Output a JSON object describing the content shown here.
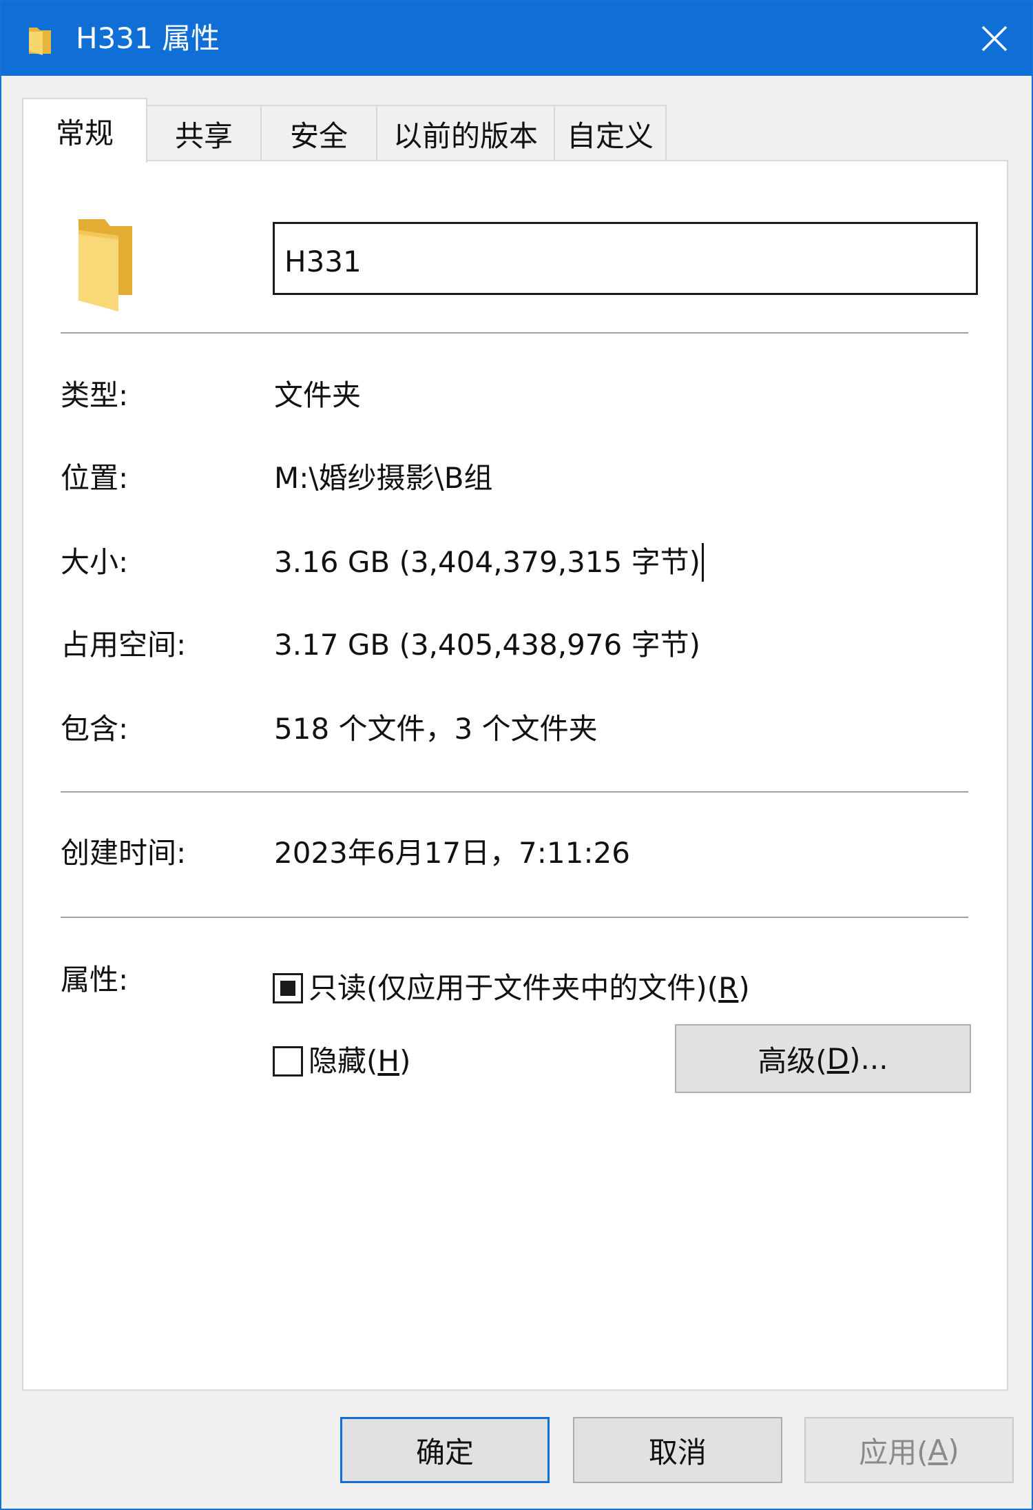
{
  "window": {
    "title": "H331 属性",
    "icon": "folder-icon",
    "close_icon": "close-icon"
  },
  "tabs": [
    {
      "label": "常规",
      "active": true
    },
    {
      "label": "共享",
      "active": false
    },
    {
      "label": "安全",
      "active": false
    },
    {
      "label": "以前的版本",
      "active": false
    },
    {
      "label": "自定义",
      "active": false
    }
  ],
  "general": {
    "name_value": "H331",
    "type_label": "类型:",
    "type_value": "文件夹",
    "location_label": "位置:",
    "location_value": "M:\\婚纱摄影\\B组",
    "size_label": "大小:",
    "size_value": "3.16 GB (3,404,379,315 字节)",
    "disk_label": "占用空间:",
    "disk_value": "3.17 GB (3,405,438,976 字节)",
    "contains_label": "包含:",
    "contains_value": "518 个文件，3 个文件夹",
    "created_label": "创建时间:",
    "created_value": "2023年6月17日，7:11:26",
    "attributes_label": "属性:",
    "readonly_label_pre": "只读(仅应用于文件夹中的文件)(",
    "readonly_hotkey": "R",
    "readonly_label_post": ")",
    "readonly_state": "indeterminate",
    "hidden_label_pre": "隐藏(",
    "hidden_hotkey": "H",
    "hidden_label_post": ")",
    "hidden_checked": false,
    "advanced_pre": "高级(",
    "advanced_hotkey": "D",
    "advanced_post": ")..."
  },
  "footer": {
    "ok": "确定",
    "cancel": "取消",
    "apply_pre": "应用(",
    "apply_hotkey": "A",
    "apply_post": ")"
  },
  "colors": {
    "titlebar": "#0f6fd6",
    "folder_yellow": "#f5c84c",
    "primary_border": "#0f6fd6"
  }
}
